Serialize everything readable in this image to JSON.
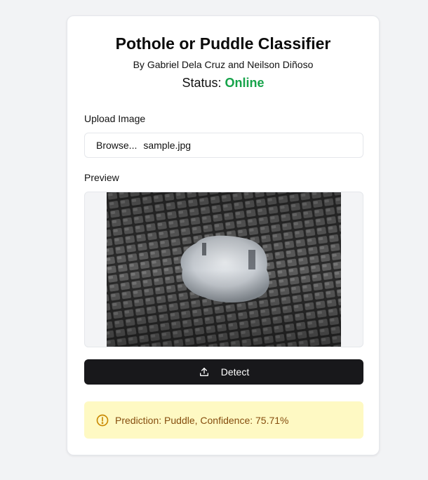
{
  "header": {
    "title": "Pothole or Puddle Classifier",
    "authors": "By Gabriel Dela Cruz and Neilson Diñoso",
    "status_label": "Status:",
    "status_value": "Online",
    "status_color": "#16a34a"
  },
  "upload": {
    "label": "Upload Image",
    "browse_label": "Browse...",
    "file_name": "sample.jpg"
  },
  "preview": {
    "label": "Preview"
  },
  "detect": {
    "label": "Detect",
    "icon": "upload-icon"
  },
  "result": {
    "icon": "alert-circle-icon",
    "text": "Prediction: Puddle, Confidence: 75.71%",
    "bg_color": "#fef9c3",
    "text_color": "#854d0e"
  }
}
